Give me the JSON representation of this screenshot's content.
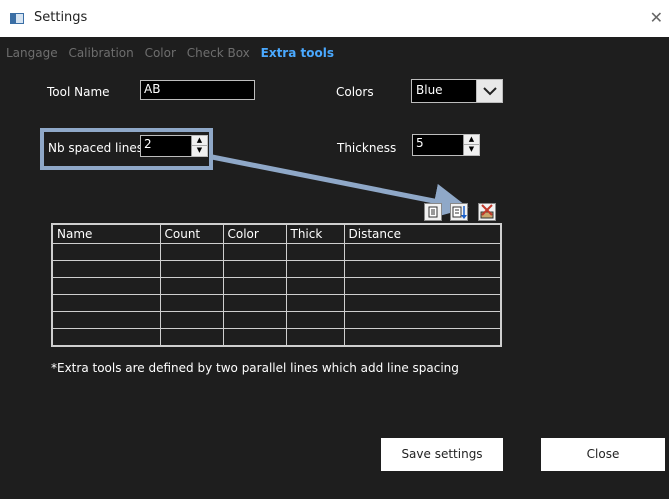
{
  "window": {
    "title": "Settings"
  },
  "tabs": [
    "Langage",
    "Calibration",
    "Color",
    "Check Box",
    "Extra tools"
  ],
  "active_tab": "Extra tools",
  "form": {
    "tool_name_label": "Tool Name",
    "tool_name_value": "AB",
    "colors_label": "Colors",
    "colors_value": "Blue",
    "nb_spaced_lines_label": "Nb spaced lines",
    "nb_spaced_lines_value": "2",
    "thickness_label": "Thickness",
    "thickness_value": "5"
  },
  "table": {
    "columns": [
      "Name",
      "Count",
      "Color",
      "Thick",
      "Distance"
    ],
    "rows": [
      [
        "",
        "",
        "",
        "",
        ""
      ],
      [
        "",
        "",
        "",
        "",
        ""
      ],
      [
        "",
        "",
        "",
        "",
        ""
      ],
      [
        "",
        "",
        "",
        "",
        ""
      ],
      [
        "",
        "",
        "",
        "",
        ""
      ],
      [
        "",
        "",
        "",
        "",
        ""
      ]
    ]
  },
  "toolbar_icons": [
    "add-row-icon",
    "insert-row-icon",
    "delete-row-icon"
  ],
  "note": "*Extra tools are defined by two parallel lines which add  line spacing",
  "buttons": {
    "save": "Save settings",
    "close": "Close"
  },
  "colors": {
    "background": "#1e1e1e",
    "active_tab": "#4aa9ff",
    "highlight": "#8fa8c8"
  }
}
